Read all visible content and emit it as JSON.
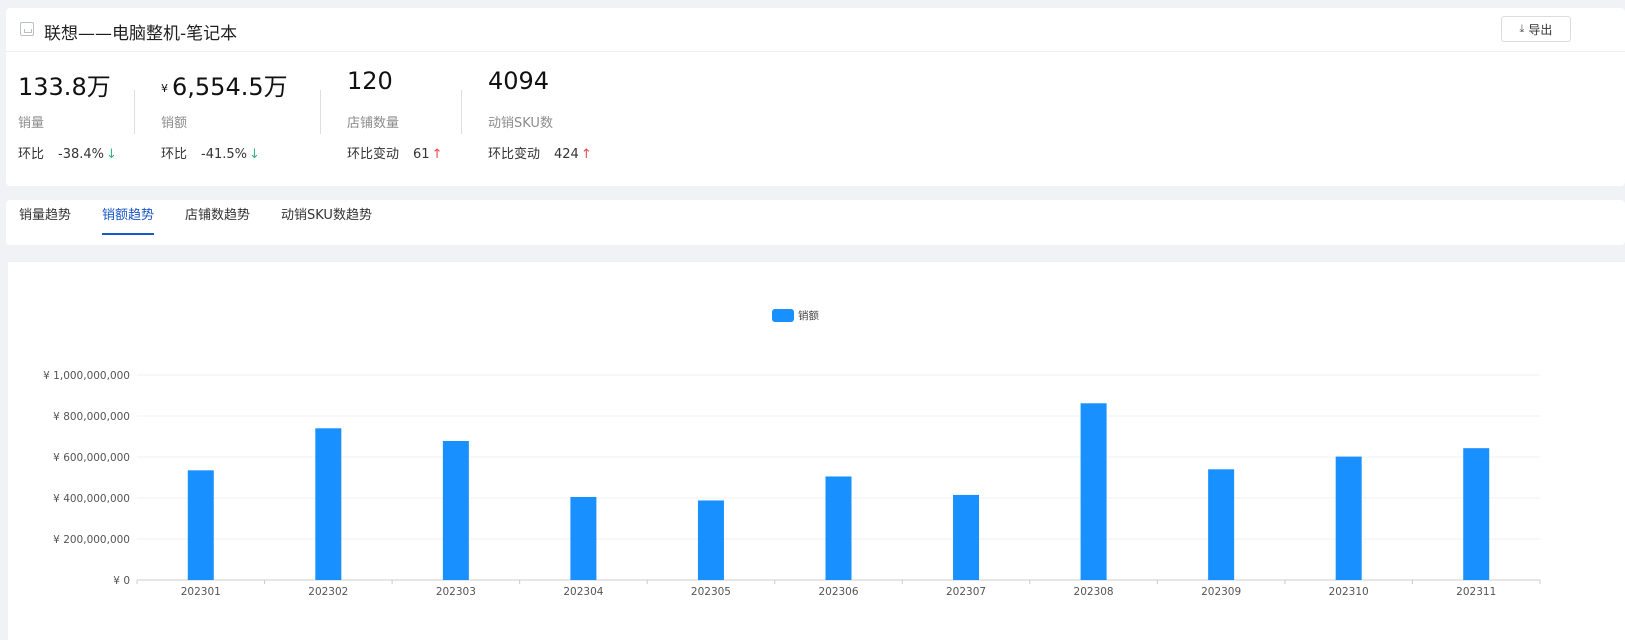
{
  "header": {
    "title": "联想——电脑整机-笔记本",
    "export_label": "导出"
  },
  "metrics": [
    {
      "value": "133.8万",
      "label": "销量",
      "change_label": "环比",
      "change_value": "-38.4%",
      "arrow": "↓"
    },
    {
      "currency": "¥",
      "value": "6,554.5万",
      "label": "销额",
      "change_label": "环比",
      "change_value": "-41.5%",
      "arrow": "↓"
    },
    {
      "value": "120",
      "label": "店铺数量",
      "change_label": "环比变动",
      "change_value": "61",
      "arrow": "↑"
    },
    {
      "value": "4094",
      "label": "动销SKU数",
      "change_label": "环比变动",
      "change_value": "424",
      "arrow": "↑"
    }
  ],
  "tabs": [
    {
      "label": "销量趋势",
      "active": false
    },
    {
      "label": "销额趋势",
      "active": true
    },
    {
      "label": "店铺数趋势",
      "active": false
    },
    {
      "label": "动销SKU数趋势",
      "active": false
    }
  ],
  "colors": {
    "bar": "#1890ff",
    "accent": "#1a56c5",
    "down": "#36b37e",
    "up": "#e5484d"
  },
  "chart_data": {
    "type": "bar",
    "categories": [
      "202301",
      "202302",
      "202303",
      "202304",
      "202305",
      "202306",
      "202307",
      "202308",
      "202309",
      "202310",
      "202311"
    ],
    "series": [
      {
        "name": "销额",
        "values": [
          535000000,
          740000000,
          678000000,
          405000000,
          388000000,
          505000000,
          415000000,
          862000000,
          540000000,
          602000000,
          643000000
        ]
      }
    ],
    "y_ticks": [
      0,
      200000000,
      400000000,
      600000000,
      800000000,
      1000000000
    ],
    "y_tick_labels": [
      "¥ 0",
      "¥ 200,000,000",
      "¥ 400,000,000",
      "¥ 600,000,000",
      "¥ 800,000,000",
      "¥ 1,000,000,000"
    ],
    "ylim": [
      0,
      1000000000
    ],
    "legend_position": "top-center",
    "grid": true
  }
}
